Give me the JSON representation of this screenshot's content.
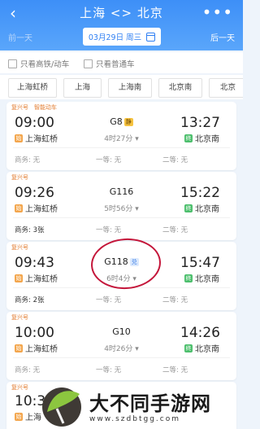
{
  "header": {
    "back_icon": "chevron-left-icon",
    "title": "上海 <> 北京",
    "more_icon": "more-dots-icon",
    "prev_day": "前一天",
    "date": "03月29日 周三",
    "next_day": "后一天"
  },
  "filters": {
    "high_speed": "只看高铁/动车",
    "regular": "只看普通车"
  },
  "stations": [
    "上海虹桥",
    "上海",
    "上海南",
    "北京南",
    "北京"
  ],
  "trains": [
    {
      "tag": "复兴号",
      "tag2": "智能动车",
      "dep_time": "09:00",
      "arr_time": "13:27",
      "train_no": "G8",
      "badge": "静",
      "duration": "4时27分",
      "dep_station": "上海虹桥",
      "arr_station": "北京南",
      "dep_icon": "始",
      "arr_icon": "终",
      "seat_business": "商务: 无",
      "seat_first": "一等: 无",
      "seat_second": "二等: 无"
    },
    {
      "tag": "复兴号",
      "tag2": "",
      "dep_time": "09:26",
      "arr_time": "15:22",
      "train_no": "G116",
      "badge": "",
      "duration": "5时56分",
      "dep_station": "上海虹桥",
      "arr_station": "北京南",
      "dep_icon": "始",
      "arr_icon": "终",
      "seat_business": "商务: 3张",
      "seat_first": "一等: 无",
      "seat_second": "二等: 无"
    },
    {
      "tag": "复兴号",
      "tag2": "",
      "dep_time": "09:43",
      "arr_time": "15:47",
      "train_no": "G118",
      "badge": "兑",
      "duration": "6时4分",
      "dep_station": "上海虹桥",
      "arr_station": "北京南",
      "dep_icon": "始",
      "arr_icon": "终",
      "seat_business": "商务: 2张",
      "seat_first": "一等: 无",
      "seat_second": "二等: 无"
    },
    {
      "tag": "复兴号",
      "tag2": "",
      "dep_time": "10:00",
      "arr_time": "14:26",
      "train_no": "G10",
      "badge": "",
      "duration": "4时26分",
      "dep_station": "上海虹桥",
      "arr_station": "北京南",
      "dep_icon": "始",
      "arr_icon": "终",
      "seat_business": "商务: 无",
      "seat_first": "一等: 无",
      "seat_second": "二等: 无"
    },
    {
      "tag": "复兴号",
      "tag2": "",
      "dep_time": "10:3",
      "arr_time": "",
      "train_no": "",
      "badge": "",
      "duration": "",
      "dep_station": "上海",
      "arr_station": "",
      "dep_icon": "始",
      "arr_icon": "",
      "seat_business": "",
      "seat_first": "",
      "seat_second": ""
    }
  ],
  "watermark": {
    "text": "大不同手游网",
    "url": "www.szdbtgg.com"
  },
  "colors": {
    "header": "#3d8ff7",
    "accent": "#2f7ff3",
    "annotation": "#c4163a"
  }
}
